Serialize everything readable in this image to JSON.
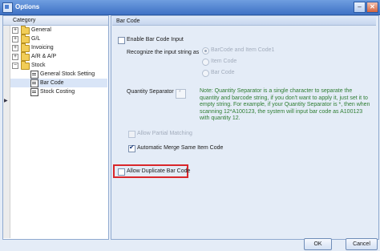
{
  "window": {
    "title": "Options"
  },
  "titlebar": {
    "minimize_glyph": "–",
    "close_glyph": "✕"
  },
  "tree": {
    "header": "Category",
    "items": [
      {
        "label": "General",
        "expander": "+",
        "icon": "folder-icon"
      },
      {
        "label": "G/L",
        "expander": "+",
        "icon": "folder-icon"
      },
      {
        "label": "Invoicing",
        "expander": "+",
        "icon": "folder-icon"
      },
      {
        "label": "A/R & A/P",
        "expander": "+",
        "icon": "folder-icon"
      },
      {
        "label": "Stock",
        "expander": "−",
        "icon": "folder-icon"
      },
      {
        "label": "General Stock Setting",
        "icon": "form-icon"
      },
      {
        "label": "Bar Code",
        "icon": "form-icon",
        "selected": true
      },
      {
        "label": "Stock Costing",
        "icon": "form-icon"
      }
    ]
  },
  "barcode": {
    "group_title": "Bar Code",
    "enable_label": "Enable Bar Code Input",
    "recognize_label": "Recognize the input string as",
    "options": [
      "BarCode and Item Code1",
      "Item Code",
      "Bar Code"
    ],
    "quantity_separator_label": "Quantity Separator",
    "quantity_separator_value": "*",
    "note": "Note: Quantity Separator is a single character to separate the quantity and barcode string, if you don't want to apply it, just set it to empty string. For example, if your Quantity Separator is *, then when scanning 12*A100123, the system will input bar code as A100123 with quantity 12.",
    "allow_partial_label": "Allow Partial Matching",
    "auto_merge_label": "Automatic Merge Same Item Code",
    "allow_duplicate_label": "Allow Duplicate Bar Code"
  },
  "buttons": {
    "ok": "OK",
    "cancel": "Cancel"
  },
  "colors": {
    "note_text": "#2e7d32",
    "highlight_border": "#d9272b",
    "title_bar": "#3f72c5"
  }
}
